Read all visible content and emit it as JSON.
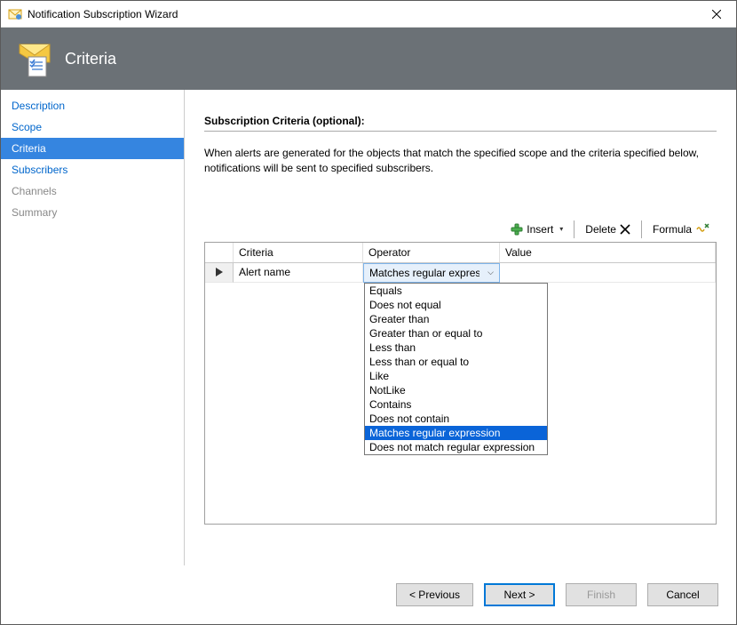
{
  "window": {
    "title": "Notification Subscription Wizard"
  },
  "header": {
    "title": "Criteria"
  },
  "sidebar": {
    "items": [
      {
        "label": "Description",
        "active": false,
        "disabled": false
      },
      {
        "label": "Scope",
        "active": false,
        "disabled": false
      },
      {
        "label": "Criteria",
        "active": true,
        "disabled": false
      },
      {
        "label": "Subscribers",
        "active": false,
        "disabled": false
      },
      {
        "label": "Channels",
        "active": false,
        "disabled": true
      },
      {
        "label": "Summary",
        "active": false,
        "disabled": true
      }
    ]
  },
  "main": {
    "heading": "Subscription Criteria (optional):",
    "description": "When alerts are generated for the objects that match the specified scope and the criteria specified below, notifications will be sent to specified subscribers.",
    "toolbar": {
      "insert": "Insert",
      "delete": "Delete",
      "formula": "Formula"
    },
    "grid": {
      "headers": {
        "criteria": "Criteria",
        "operator": "Operator",
        "value": "Value"
      },
      "row": {
        "criteria": "Alert name",
        "operator_display": "Matches regular expression",
        "value": ""
      },
      "operator_options": [
        "Equals",
        "Does not equal",
        "Greater than",
        "Greater than or equal to",
        "Less than",
        "Less than or equal to",
        "Like",
        "NotLike",
        "Contains",
        "Does not contain",
        "Matches regular expression",
        "Does not match regular expression"
      ],
      "selected_operator": "Matches regular expression"
    }
  },
  "footer": {
    "previous": "< Previous",
    "next": "Next >",
    "finish": "Finish",
    "cancel": "Cancel"
  }
}
